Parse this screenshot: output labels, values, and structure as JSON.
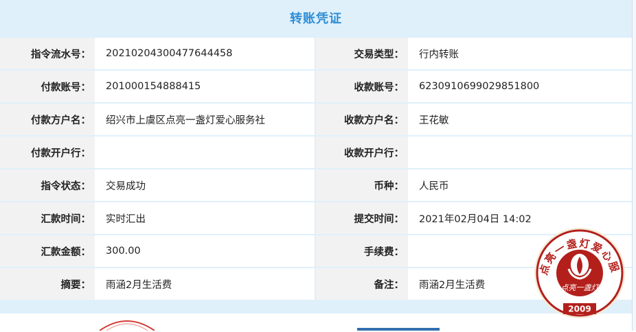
{
  "header": {
    "title": "转账凭证"
  },
  "rows": [
    {
      "left_label": "指令流水号：",
      "left_value": "20210204300477644458",
      "right_label": "交易类型：",
      "right_value": "行内转账"
    },
    {
      "left_label": "付款账号：",
      "left_value": "201000154888415",
      "right_label": "收款账号：",
      "right_value": "6230910699029851800"
    },
    {
      "left_label": "付款方户名：",
      "left_value": "绍兴市上虞区点亮一盏灯爱心服务社",
      "right_label": "收款方户名：",
      "right_value": "王花敏"
    },
    {
      "left_label": "付款开户行：",
      "left_value": "",
      "right_label": "收款开户行：",
      "right_value": ""
    },
    {
      "left_label": "指令状态：",
      "left_value": "交易成功",
      "right_label": "币种：",
      "right_value": "人民币"
    },
    {
      "left_label": "汇款时间：",
      "left_value": "实时汇出",
      "right_label": "提交时间：",
      "right_value": "2021年02月04日 14:02"
    },
    {
      "left_label": "汇款金额：",
      "left_value": "300.00",
      "right_label": "手续费：",
      "right_value": ""
    },
    {
      "left_label": "摘要：",
      "left_value": "雨涵2月生活费",
      "right_label": "备注：",
      "right_value": "雨涵2月生活费"
    }
  ],
  "seal": {
    "ring_text": "点亮一盏灯爱心服务社",
    "center_text": "点亮一盏灯",
    "year": "2009",
    "color": "#b3201c"
  }
}
